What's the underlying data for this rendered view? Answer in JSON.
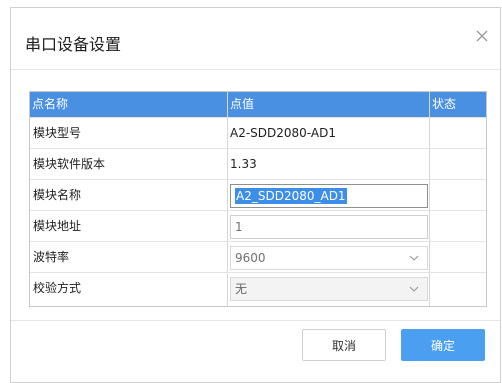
{
  "dialog": {
    "title": "串口设备设置",
    "close_icon": "close-icon"
  },
  "table": {
    "headers": {
      "name": "点名称",
      "value": "点值",
      "status": "状态"
    },
    "rows": [
      {
        "label": "模块型号",
        "value": "A2-SDD2080-AD1"
      },
      {
        "label": "模块软件版本",
        "value": "1.33"
      },
      {
        "label": "模块名称",
        "value": "A2_SDD2080_AD1"
      },
      {
        "label": "模块地址",
        "value": "1"
      },
      {
        "label": "波特率",
        "value": "9600"
      },
      {
        "label": "校验方式",
        "value": "无"
      }
    ]
  },
  "buttons": {
    "cancel": "取消",
    "ok": "确定"
  },
  "colors": {
    "header_bg": "#4a90e2",
    "ok_bg": "#4a9ff0",
    "selection": "#3d8ee8"
  }
}
